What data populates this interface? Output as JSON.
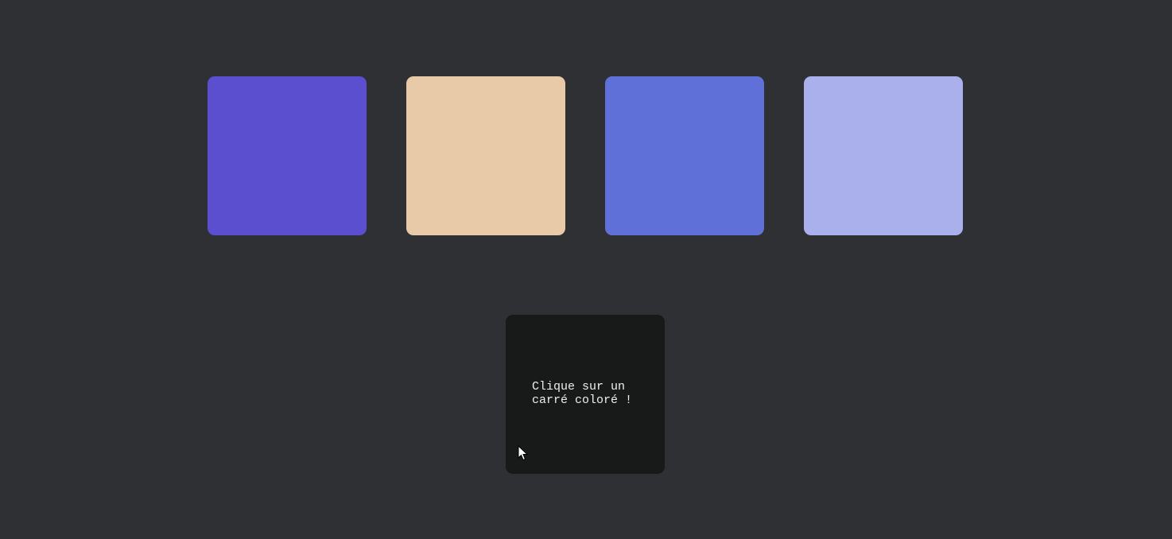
{
  "swatches": [
    {
      "color": "#5b4fcf"
    },
    {
      "color": "#e8caa8"
    },
    {
      "color": "#5f71d8"
    },
    {
      "color": "#a9b0eb"
    }
  ],
  "display": {
    "background": "#181919",
    "message": "Clique sur un carré coloré !"
  },
  "cursor": {
    "icon": "mouse-pointer-icon"
  }
}
